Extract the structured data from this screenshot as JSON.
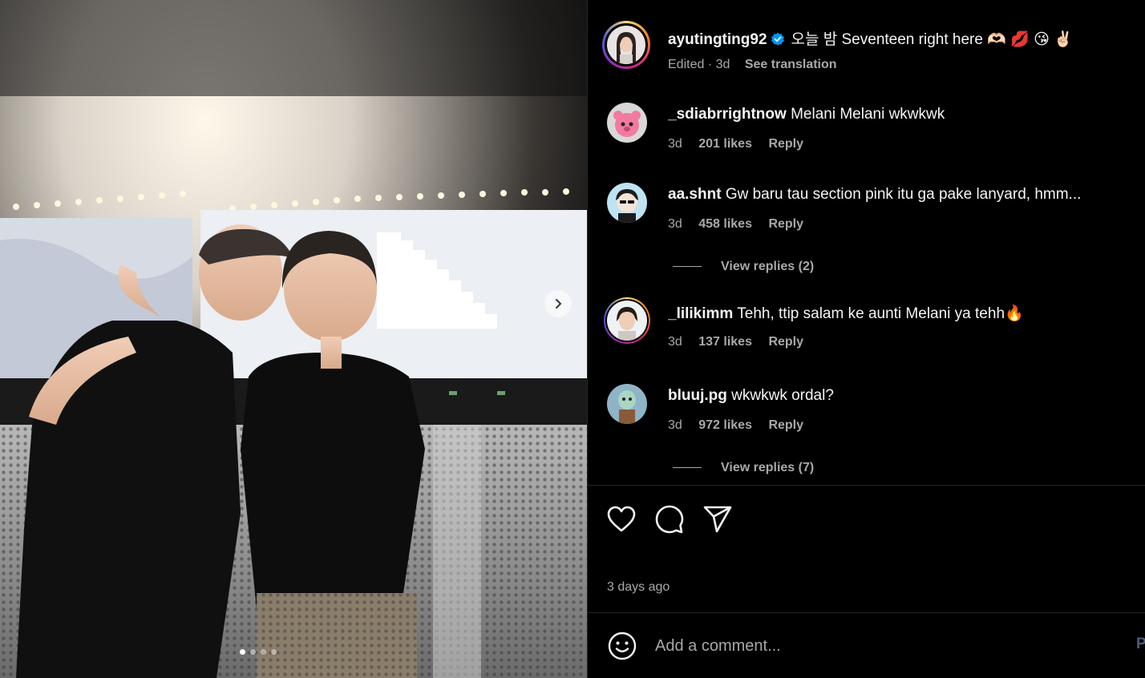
{
  "post": {
    "username": "ayutingting92",
    "verified": true,
    "caption": "오늘 밤 Seventeen right here 🫶🏻 💋 😘 ✌🏻",
    "edited_label": "Edited · 3d",
    "see_translation": "See translation"
  },
  "media": {
    "next_icon": "chevron-right-icon",
    "carousel_count": 4,
    "active_index": 0
  },
  "comments": [
    {
      "username": "_sdiabrrightnow",
      "text": "Melani Melani wkwkwk",
      "time": "3d",
      "likes": "201 likes",
      "reply": "Reply"
    },
    {
      "username": "aa.shnt",
      "text": "Gw baru tau section pink itu ga pake lanyard, hmm...",
      "time": "3d",
      "likes": "458 likes",
      "reply": "Reply",
      "view_replies": "View replies (2)"
    },
    {
      "username": "_lilikimm",
      "text": "Tehh, ttip salam ke aunti Melani ya tehh🔥",
      "time": "3d",
      "likes": "137 likes",
      "reply": "Reply"
    },
    {
      "username": "bluuj.pg",
      "text": "wkwkwk ordal?",
      "time": "3d",
      "likes": "972 likes",
      "reply": "Reply",
      "view_replies": "View replies (7)"
    }
  ],
  "actions": {
    "like_icon": "heart-icon",
    "comment_icon": "comment-bubble-icon",
    "share_icon": "paper-plane-icon",
    "timestamp": "3 days ago"
  },
  "composer": {
    "emoji_icon": "smiley-icon",
    "placeholder": "Add a comment...",
    "post_label": "P"
  },
  "colors": {
    "background": "#000000",
    "text_primary": "#f5f5f5",
    "text_secondary": "#a8a8a8",
    "verified_blue": "#0095f6",
    "divider": "#262626"
  }
}
